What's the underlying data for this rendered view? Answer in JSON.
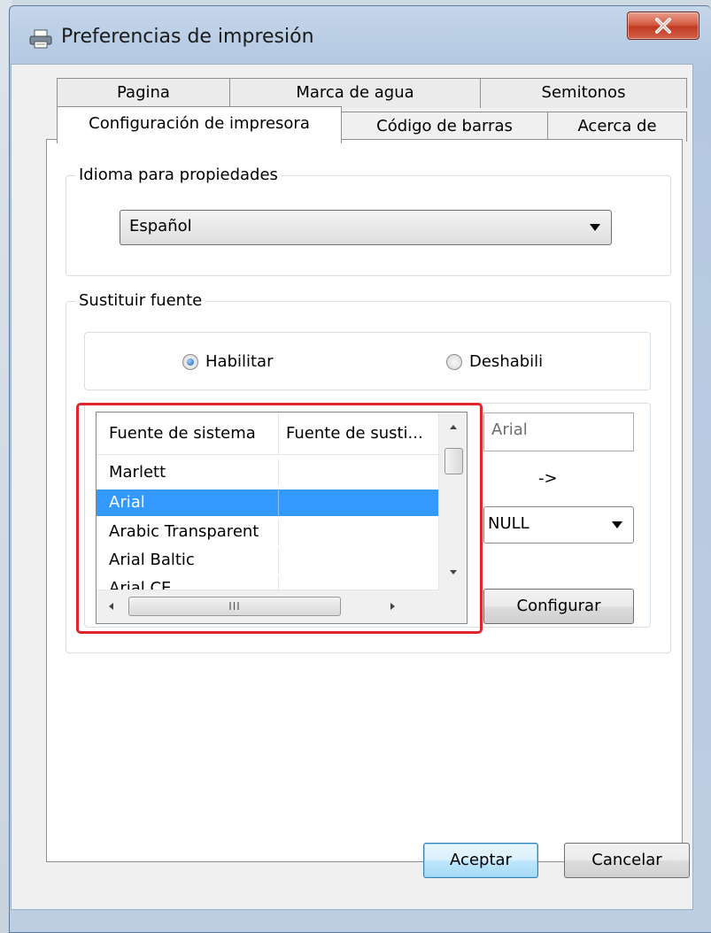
{
  "window": {
    "title": "Preferencias de impresión",
    "close_label": "X"
  },
  "tabs": {
    "row_back": [
      "Pagina",
      "Marca de agua",
      "Semitonos"
    ],
    "row_front": [
      "Configuración de impresora",
      "Código de barras",
      "Acerca de"
    ],
    "active": "Configuración de impresora"
  },
  "language_group": {
    "label": "Idioma para propiedades",
    "selected": "Español"
  },
  "font_sub_group": {
    "label": "Sustituir fuente",
    "enable_label": "Habilitar",
    "disable_label": "Deshabili",
    "enable_checked": true
  },
  "font_table": {
    "columns": [
      "Fuente de sistema",
      "Fuente de susti..."
    ],
    "rows": [
      {
        "system": "Marlett",
        "substitute": ""
      },
      {
        "system": "Arial",
        "substitute": "",
        "selected": true
      },
      {
        "system": "Arabic Transparent",
        "substitute": ""
      },
      {
        "system": "Arial Baltic",
        "substitute": ""
      },
      {
        "system": "Arial CE",
        "substitute": ""
      }
    ],
    "hscroll_grip": "III"
  },
  "mapping": {
    "source_font": "Arial",
    "arrow": "->",
    "target_font": "NULL",
    "configure_label": "Configurar"
  },
  "footer": {
    "ok_label": "Aceptar",
    "cancel_label": "Cancelar"
  },
  "colors": {
    "selection": "#3399ff",
    "highlight_border": "#e0262a",
    "close_button": "#c23a22"
  }
}
